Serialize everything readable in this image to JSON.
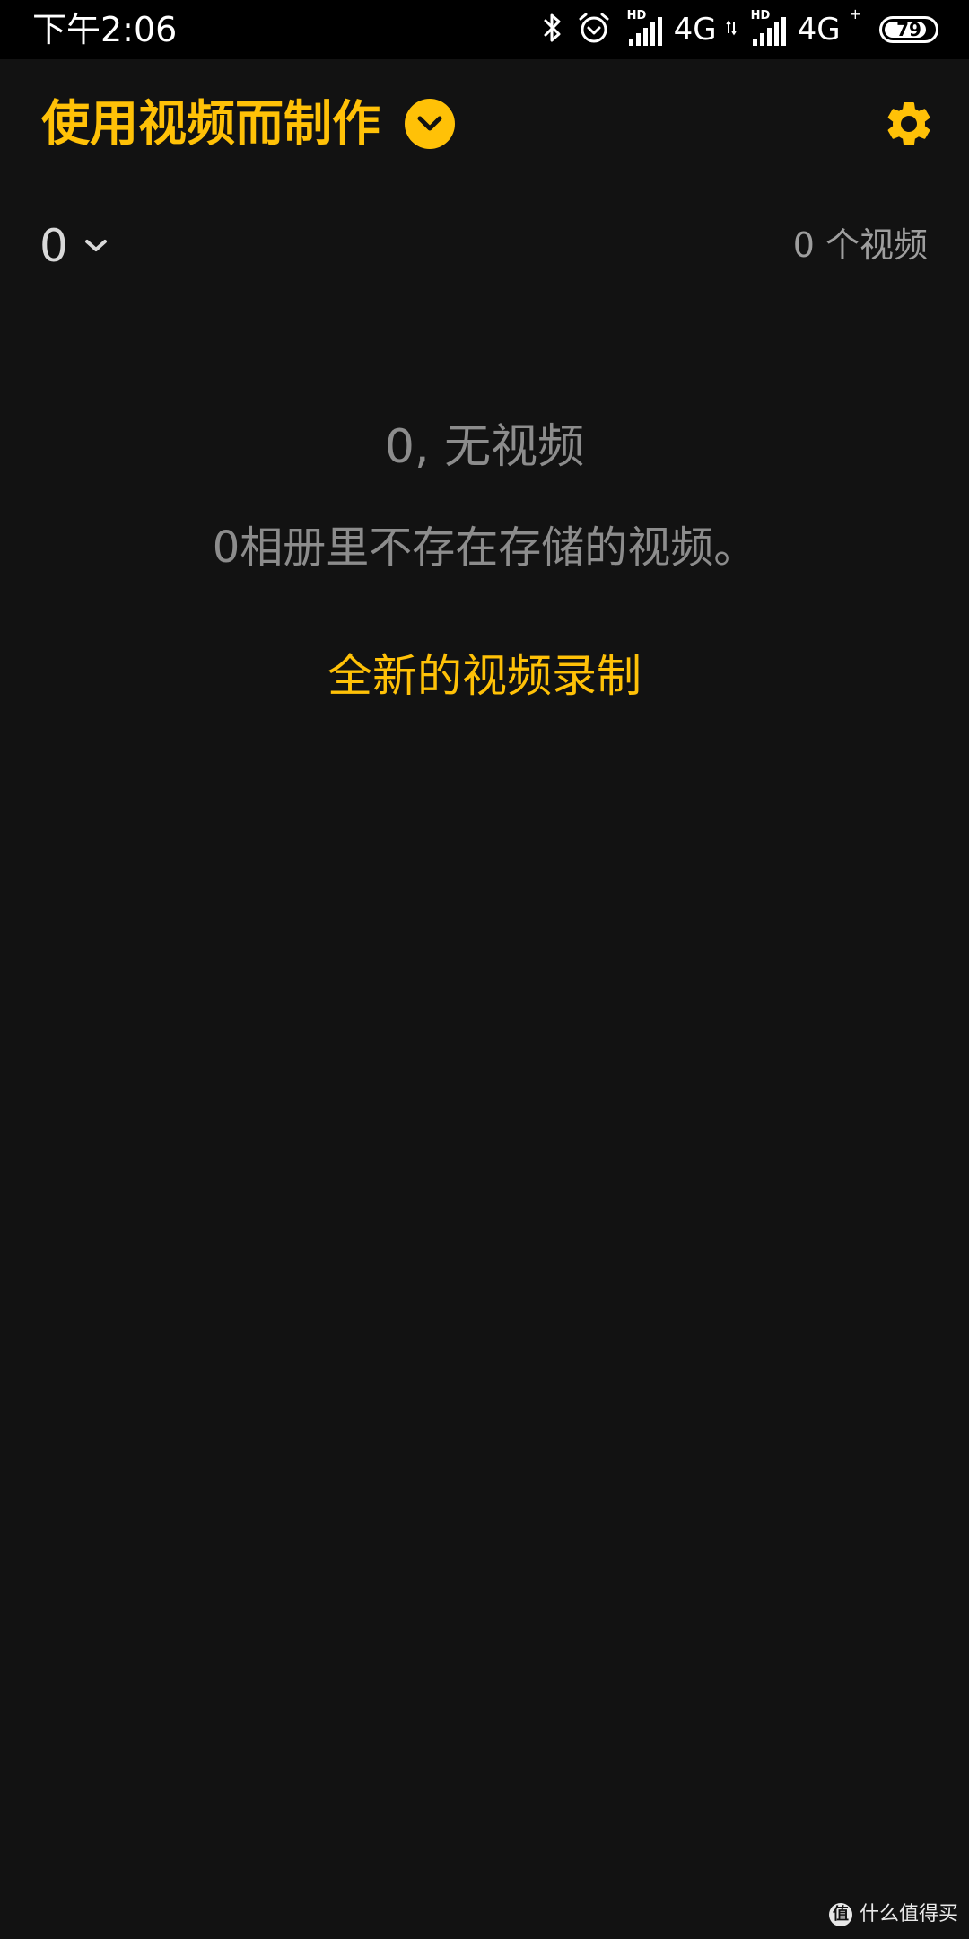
{
  "status_bar": {
    "time": "下午2:06",
    "sim1": {
      "hd": "HD",
      "network": "4G",
      "signal_bars": 5
    },
    "sim2": {
      "hd": "HD",
      "network": "4G",
      "network_suffix": "+",
      "signal_bars": 5
    },
    "battery_level": "79",
    "icons": [
      "bluetooth-icon",
      "alarm-icon"
    ]
  },
  "header": {
    "title": "使用视频而制作",
    "dropdown_icon": "chevron-down-circle-icon",
    "settings_icon": "gear-icon"
  },
  "album_bar": {
    "album_name": "0",
    "album_dropdown_icon": "chevron-down-icon",
    "video_count": "0 个视频"
  },
  "empty_state": {
    "title": "0, 无视频",
    "description": "0相册里不存在存储的视频。",
    "action_label": "全新的视频录制"
  },
  "watermark": {
    "logo": "值",
    "text": "什么值得买"
  },
  "colors": {
    "accent": "#FFC107",
    "background": "#121212",
    "status_bar": "#000000",
    "muted_text": "#8c8c8c"
  }
}
